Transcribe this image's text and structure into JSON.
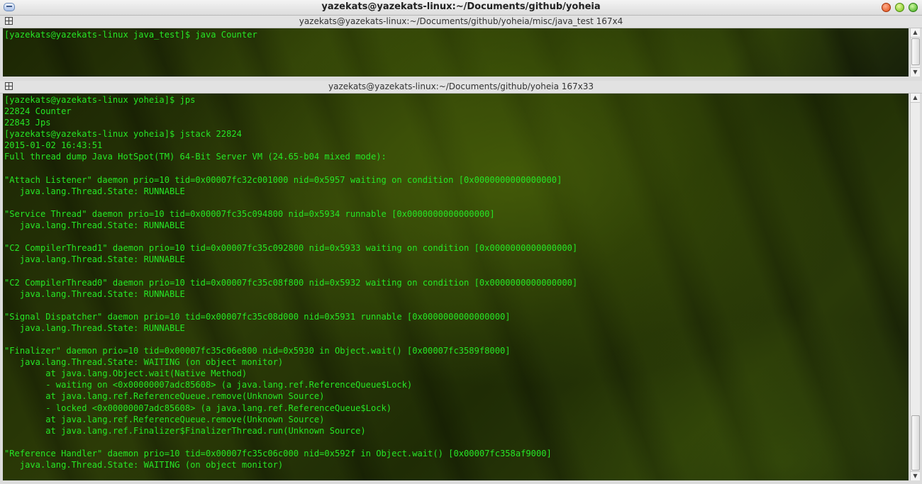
{
  "window": {
    "title": "yazekats@yazekats-linux:~/Documents/github/yoheia"
  },
  "icons": {
    "window_menu": "window-menu-icon",
    "close": "close-icon",
    "minimize": "minimize-icon",
    "maximize": "maximize-icon",
    "split": "split-view-icon",
    "scroll_up": "arrow-up-icon",
    "scroll_down": "arrow-down-icon"
  },
  "colors": {
    "terminal_text": "#26e626",
    "close": "#e04a10",
    "minimize": "#6cc010",
    "maximize": "#38a818"
  },
  "pane_top": {
    "title": "yazekats@yazekats-linux:~/Documents/github/yoheia/misc/java_test 167x4",
    "lines": [
      "[yazekats@yazekats-linux java_test]$ java Counter"
    ]
  },
  "pane_bottom": {
    "title": "yazekats@yazekats-linux:~/Documents/github/yoheia 167x33",
    "lines": [
      "[yazekats@yazekats-linux yoheia]$ jps",
      "22824 Counter",
      "22843 Jps",
      "[yazekats@yazekats-linux yoheia]$ jstack 22824",
      "2015-01-02 16:43:51",
      "Full thread dump Java HotSpot(TM) 64-Bit Server VM (24.65-b04 mixed mode):",
      "",
      "\"Attach Listener\" daemon prio=10 tid=0x00007fc32c001000 nid=0x5957 waiting on condition [0x0000000000000000]",
      "   java.lang.Thread.State: RUNNABLE",
      "",
      "\"Service Thread\" daemon prio=10 tid=0x00007fc35c094800 nid=0x5934 runnable [0x0000000000000000]",
      "   java.lang.Thread.State: RUNNABLE",
      "",
      "\"C2 CompilerThread1\" daemon prio=10 tid=0x00007fc35c092800 nid=0x5933 waiting on condition [0x0000000000000000]",
      "   java.lang.Thread.State: RUNNABLE",
      "",
      "\"C2 CompilerThread0\" daemon prio=10 tid=0x00007fc35c08f800 nid=0x5932 waiting on condition [0x0000000000000000]",
      "   java.lang.Thread.State: RUNNABLE",
      "",
      "\"Signal Dispatcher\" daemon prio=10 tid=0x00007fc35c08d000 nid=0x5931 runnable [0x0000000000000000]",
      "   java.lang.Thread.State: RUNNABLE",
      "",
      "\"Finalizer\" daemon prio=10 tid=0x00007fc35c06e800 nid=0x5930 in Object.wait() [0x00007fc3589f8000]",
      "   java.lang.Thread.State: WAITING (on object monitor)",
      "\tat java.lang.Object.wait(Native Method)",
      "\t- waiting on <0x00000007adc85608> (a java.lang.ref.ReferenceQueue$Lock)",
      "\tat java.lang.ref.ReferenceQueue.remove(Unknown Source)",
      "\t- locked <0x00000007adc85608> (a java.lang.ref.ReferenceQueue$Lock)",
      "\tat java.lang.ref.ReferenceQueue.remove(Unknown Source)",
      "\tat java.lang.ref.Finalizer$FinalizerThread.run(Unknown Source)",
      "",
      "\"Reference Handler\" daemon prio=10 tid=0x00007fc35c06c000 nid=0x592f in Object.wait() [0x00007fc358af9000]",
      "   java.lang.Thread.State: WAITING (on object monitor)"
    ]
  }
}
